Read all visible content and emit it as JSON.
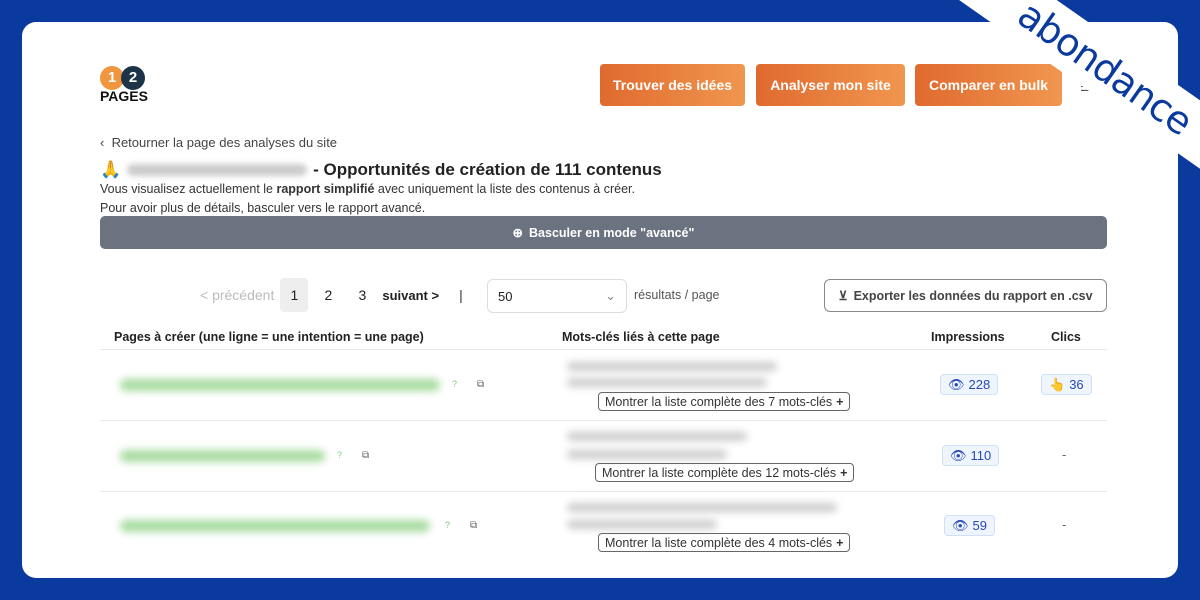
{
  "watermark": "abondance",
  "logo": {
    "one": "1",
    "two": "2",
    "text": "PAGES"
  },
  "header": {
    "buttons": [
      "Trouver des idées",
      "Analyser mon site",
      "Comparer en bulk"
    ]
  },
  "back_link": "Retourner la page des analyses du site",
  "title": {
    "emoji": "🙏",
    "text": "- Opportunités de création de 111 contenus"
  },
  "desc": {
    "line1_a": "Vous visualisez actuellement le ",
    "line1_b": "rapport simplifié",
    "line1_c": " avec uniquement la liste des contenus à créer.",
    "line2": "Pour avoir plus de détails, basculer vers le rapport avancé."
  },
  "toggle_label": "Basculer en mode \"avancé\"",
  "pagination": {
    "prev": "< précédent",
    "pages": [
      "1",
      "2",
      "3"
    ],
    "current": "1",
    "next": "suivant >"
  },
  "per_page": {
    "value": "50",
    "label": "résultats / page"
  },
  "export_label": "Exporter les données du rapport en .csv",
  "table": {
    "headers": [
      "Pages à créer (une ligne = une intention = une page)",
      "Mots-clés liés à cette page",
      "Impressions",
      "Clics"
    ],
    "rows": [
      {
        "more": "Montrer la liste complète des 7 mots-clés",
        "impressions": "228",
        "clics": "36"
      },
      {
        "more": "Montrer la liste complète des 12 mots-clés",
        "impressions": "110",
        "clics": "-"
      },
      {
        "more": "Montrer la liste complète des 4 mots-clés",
        "impressions": "59",
        "clics": "-"
      }
    ]
  },
  "colors": {
    "accent": "#e06a2e",
    "frame": "#0a3a9e",
    "badge_text": "#2a49b8"
  }
}
